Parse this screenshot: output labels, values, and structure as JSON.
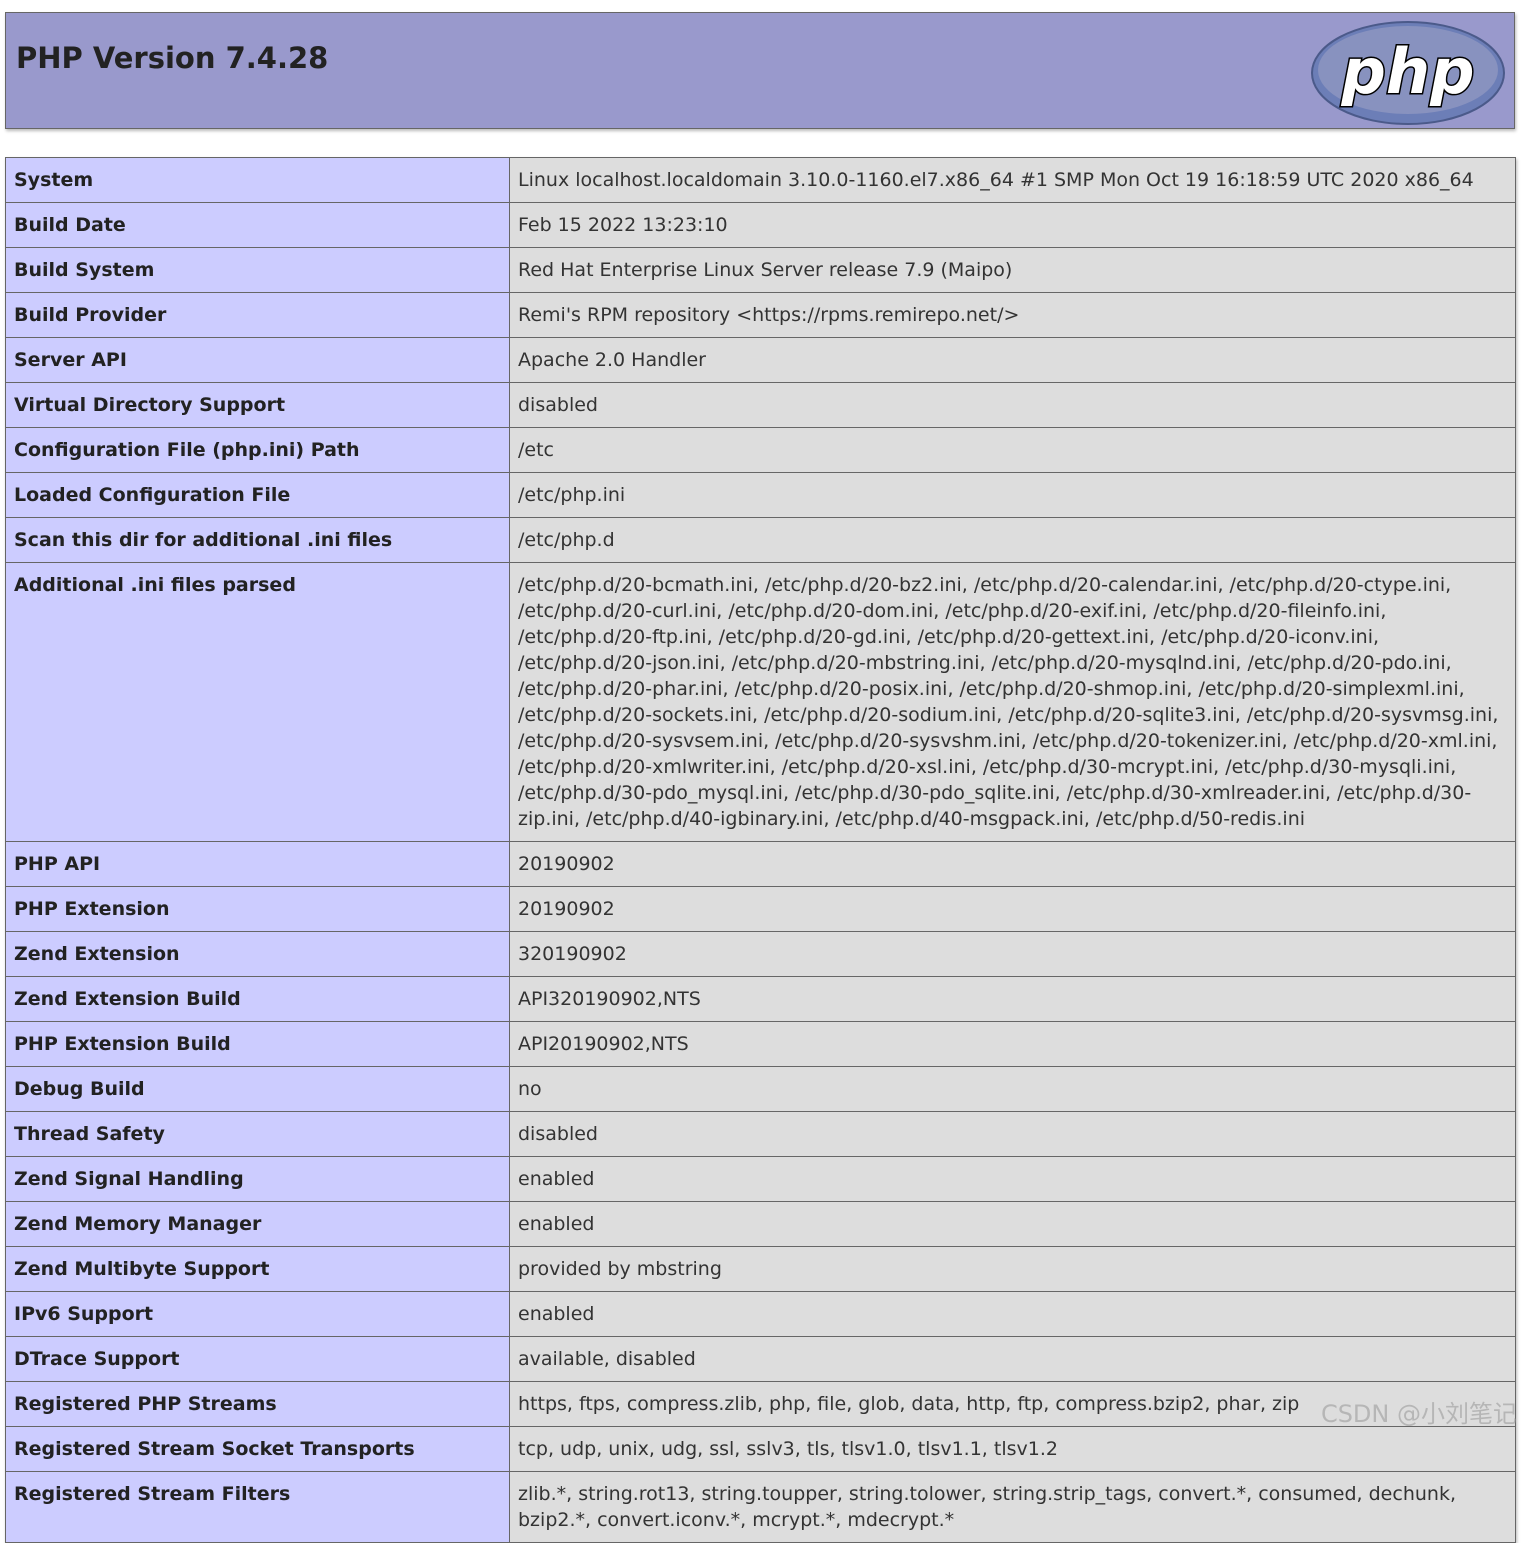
{
  "header": {
    "title": "PHP Version 7.4.28",
    "logo_text": "php",
    "colors": {
      "header_bg": "#9999cc",
      "key_bg": "#ccccff",
      "value_bg": "#dddddd"
    }
  },
  "rows": [
    {
      "key": "System",
      "value": "Linux localhost.localdomain 3.10.0-1160.el7.x86_64 #1 SMP Mon Oct 19 16:18:59 UTC 2020 x86_64"
    },
    {
      "key": "Build Date",
      "value": "Feb 15 2022 13:23:10"
    },
    {
      "key": "Build System",
      "value": "Red Hat Enterprise Linux Server release 7.9 (Maipo)"
    },
    {
      "key": "Build Provider",
      "value": "Remi's RPM repository <https://rpms.remirepo.net/>"
    },
    {
      "key": "Server API",
      "value": "Apache 2.0 Handler"
    },
    {
      "key": "Virtual Directory Support",
      "value": "disabled"
    },
    {
      "key": "Configuration File (php.ini) Path",
      "value": "/etc"
    },
    {
      "key": "Loaded Configuration File",
      "value": "/etc/php.ini"
    },
    {
      "key": "Scan this dir for additional .ini files",
      "value": "/etc/php.d"
    },
    {
      "key": "Additional .ini files parsed",
      "value": "/etc/php.d/20-bcmath.ini, /etc/php.d/20-bz2.ini, /etc/php.d/20-calendar.ini, /etc/php.d/20-ctype.ini, /etc/php.d/20-curl.ini, /etc/php.d/20-dom.ini, /etc/php.d/20-exif.ini, /etc/php.d/20-fileinfo.ini, /etc/php.d/20-ftp.ini, /etc/php.d/20-gd.ini, /etc/php.d/20-gettext.ini, /etc/php.d/20-iconv.ini, /etc/php.d/20-json.ini, /etc/php.d/20-mbstring.ini, /etc/php.d/20-mysqlnd.ini, /etc/php.d/20-pdo.ini, /etc/php.d/20-phar.ini, /etc/php.d/20-posix.ini, /etc/php.d/20-shmop.ini, /etc/php.d/20-simplexml.ini, /etc/php.d/20-sockets.ini, /etc/php.d/20-sodium.ini, /etc/php.d/20-sqlite3.ini, /etc/php.d/20-sysvmsg.ini, /etc/php.d/20-sysvsem.ini, /etc/php.d/20-sysvshm.ini, /etc/php.d/20-tokenizer.ini, /etc/php.d/20-xml.ini, /etc/php.d/20-xmlwriter.ini, /etc/php.d/20-xsl.ini, /etc/php.d/30-mcrypt.ini, /etc/php.d/30-mysqli.ini, /etc/php.d/30-pdo_mysql.ini, /etc/php.d/30-pdo_sqlite.ini, /etc/php.d/30-xmlreader.ini, /etc/php.d/30-zip.ini, /etc/php.d/40-igbinary.ini, /etc/php.d/40-msgpack.ini, /etc/php.d/50-redis.ini"
    },
    {
      "key": "PHP API",
      "value": "20190902"
    },
    {
      "key": "PHP Extension",
      "value": "20190902"
    },
    {
      "key": "Zend Extension",
      "value": "320190902"
    },
    {
      "key": "Zend Extension Build",
      "value": "API320190902,NTS"
    },
    {
      "key": "PHP Extension Build",
      "value": "API20190902,NTS"
    },
    {
      "key": "Debug Build",
      "value": "no"
    },
    {
      "key": "Thread Safety",
      "value": "disabled"
    },
    {
      "key": "Zend Signal Handling",
      "value": "enabled"
    },
    {
      "key": "Zend Memory Manager",
      "value": "enabled"
    },
    {
      "key": "Zend Multibyte Support",
      "value": "provided by mbstring"
    },
    {
      "key": "IPv6 Support",
      "value": "enabled"
    },
    {
      "key": "DTrace Support",
      "value": "available, disabled"
    },
    {
      "key": "Registered PHP Streams",
      "value": "https, ftps, compress.zlib, php, file, glob, data, http, ftp, compress.bzip2, phar, zip"
    },
    {
      "key": "Registered Stream Socket Transports",
      "value": "tcp, udp, unix, udg, ssl, sslv3, tls, tlsv1.0, tlsv1.1, tlsv1.2"
    },
    {
      "key": "Registered Stream Filters",
      "value": "zlib.*, string.rot13, string.toupper, string.tolower, string.strip_tags, convert.*, consumed, dechunk, bzip2.*, convert.iconv.*, mcrypt.*, mdecrypt.*"
    }
  ],
  "watermark": "CSDN @小刘笔记"
}
